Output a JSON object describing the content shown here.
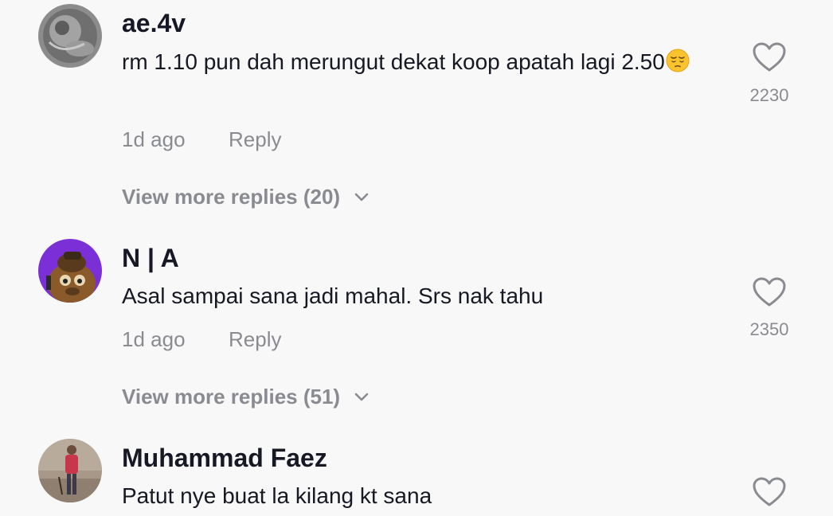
{
  "comments": [
    {
      "username": "ae.4v",
      "text": "rm 1.10 pun dah merungut dekat koop apatah lagi 2.50",
      "emoji": "pensive-face",
      "time": "1d ago",
      "reply_label": "Reply",
      "likes": "2230",
      "view_more": "View more replies (20)"
    },
    {
      "username": "N | A",
      "text": "Asal sampai sana jadi mahal. Srs nak tahu",
      "time": "1d ago",
      "reply_label": "Reply",
      "likes": "2350",
      "view_more": "View more replies (51)"
    },
    {
      "username": "Muhammad Faez",
      "text": "Patut nye buat la kilang kt sana"
    }
  ],
  "colors": {
    "background": "#f8f8f8",
    "primary_text": "#161823",
    "secondary_text": "#8a8b91"
  }
}
